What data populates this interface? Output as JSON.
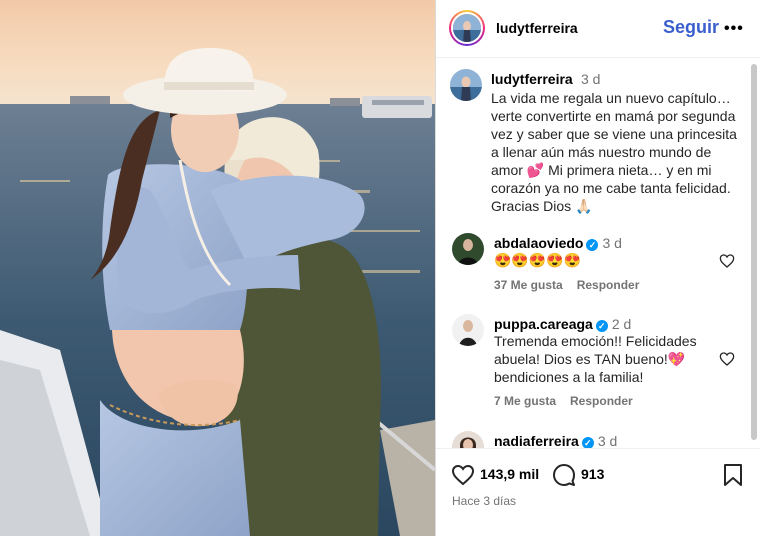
{
  "header": {
    "username": "ludytferreira",
    "follow_label": "Seguir",
    "more_label": "•••"
  },
  "caption": {
    "username": "ludytferreira",
    "time": "3 d",
    "text": "La vida me regala un nuevo capítulo… verte convertirte en mamá por segunda vez  y saber que se viene una princesita a llenar aún más nuestro mundo de amor 💕 Mi primera nieta… y en mi corazón ya no me cabe tanta felicidad. Gracias Dios 🙏🏻"
  },
  "comments": [
    {
      "username": "abdalaoviedo",
      "verified": true,
      "time": "3 d",
      "text": "😍😍😍😍😍",
      "likes": "37 Me gusta",
      "reply_label": "Responder"
    },
    {
      "username": "puppa.careaga",
      "verified": true,
      "time": "2 d",
      "text": "Tremenda emoción!! Felicidades abuela! Dios es TAN bueno!💖 bendiciones a la familia!",
      "likes": "7 Me gusta",
      "reply_label": "Responder"
    },
    {
      "username": "nadiaferreira",
      "verified": true,
      "time": "3 d"
    }
  ],
  "footer": {
    "likes_count": "143,9 mil",
    "comments_count": "913",
    "posted_ago": "Hace 3 días"
  },
  "icons": {
    "like": "heart-icon",
    "comment": "comment-bubble-icon",
    "save": "bookmark-icon",
    "more": "more-options-icon",
    "verified": "verified-badge-icon"
  },
  "colors": {
    "follow": "#3a5fcd",
    "verified": "#0095f6",
    "muted": "#737373"
  }
}
